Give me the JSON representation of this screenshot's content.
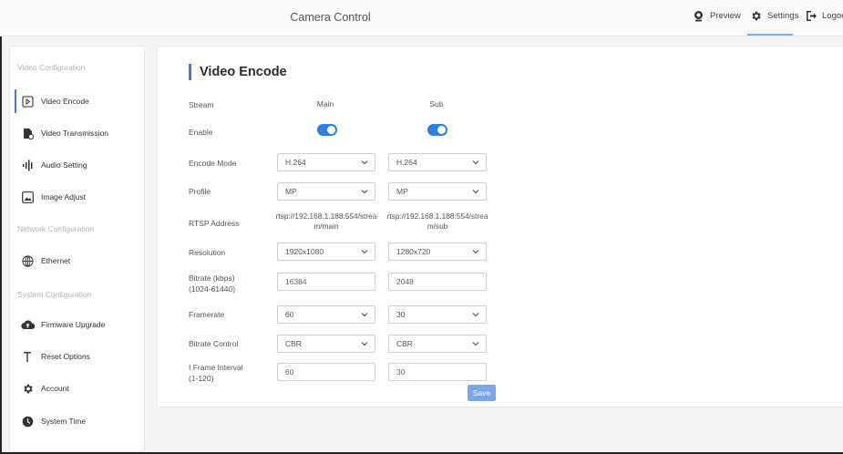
{
  "header": {
    "title": "Camera Control",
    "nav": [
      {
        "label": "Preview",
        "icon": "camera-icon"
      },
      {
        "label": "Settings",
        "icon": "gear-icon"
      },
      {
        "label": "Logou",
        "icon": "logout-icon"
      }
    ]
  },
  "sidebar": {
    "groups": [
      {
        "label": "Video Configuration"
      },
      {
        "label": "Network Configuration"
      },
      {
        "label": "System Configuration"
      }
    ],
    "items": [
      {
        "label": "Video Encode",
        "icon": "video-encode-icon",
        "active": true
      },
      {
        "label": "Video Transmission",
        "icon": "video-transmission-icon"
      },
      {
        "label": "Audio Setting",
        "icon": "audio-bars-icon"
      },
      {
        "label": "Image Adjust",
        "icon": "image-icon"
      },
      {
        "label": "Ethernet",
        "icon": "globe-icon"
      },
      {
        "label": "Firmware Upgrade",
        "icon": "cloud-upload-icon"
      },
      {
        "label": "Reset Options",
        "icon": "reset-t-icon"
      },
      {
        "label": "Account",
        "icon": "gear-icon"
      },
      {
        "label": "System Time",
        "icon": "clock-icon"
      }
    ]
  },
  "main": {
    "title": "Video Encode",
    "labels": {
      "stream": "Stream",
      "enable": "Enable",
      "encode_mode": "Encode Mode",
      "profile": "Profile",
      "rtsp": "RTSP Address",
      "resolution": "Resolution",
      "bitrate": "Bitrate (kbps)",
      "bitrate_range": "(1024-61440)",
      "framerate": "Framerate",
      "bitrate_control": "Bitrate Control",
      "iframe": "I Frame Interval",
      "iframe_range": "(1-120)"
    },
    "main_stream": {
      "heading": "Main",
      "enabled": true,
      "encode_mode": "H.264",
      "profile": "MP",
      "rtsp": "rtsp://192.168.1.188:554/stream/main",
      "resolution": "1920x1080",
      "bitrate": "16384",
      "framerate": "60",
      "bitrate_control": "CBR",
      "iframe": "60"
    },
    "sub_stream": {
      "heading": "Sub",
      "enabled": true,
      "encode_mode": "H.264",
      "profile": "MP",
      "rtsp": "rtsp://192.168.1.188:554/stream/sub",
      "resolution": "1280x720",
      "bitrate": "2048",
      "framerate": "30",
      "bitrate_control": "CBR",
      "iframe": "30"
    },
    "save_label": "Save"
  },
  "colors": {
    "accent": "#3f7fd6",
    "toggle_on": "#2f7fe0",
    "save_button": "#7aa7ea"
  }
}
